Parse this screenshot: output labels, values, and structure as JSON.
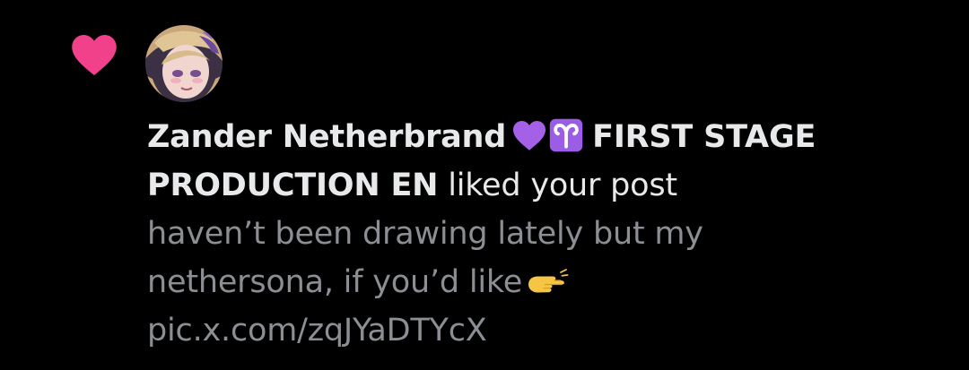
{
  "notification": {
    "type_icon": "heart-icon",
    "accent_color": "#f2418b",
    "avatar_icon": "avatar",
    "user_name_prefix": "Zander Netherbrand",
    "name_emojis": [
      "purple-heart-emoji",
      "aries-emoji"
    ],
    "user_name_suffix": "FIRST STAGE PRODUCTION EN",
    "action_text": "liked your post",
    "post_preview": {
      "text_before_emoji": "haven’t been drawing lately but my nethersona, if you’d like",
      "emoji": "pointing-hand-emoji",
      "link_text": "pic.x.com/zqJYaDTYcX"
    },
    "text_color": "#e7e9ea",
    "preview_color": "#8b8f94"
  }
}
